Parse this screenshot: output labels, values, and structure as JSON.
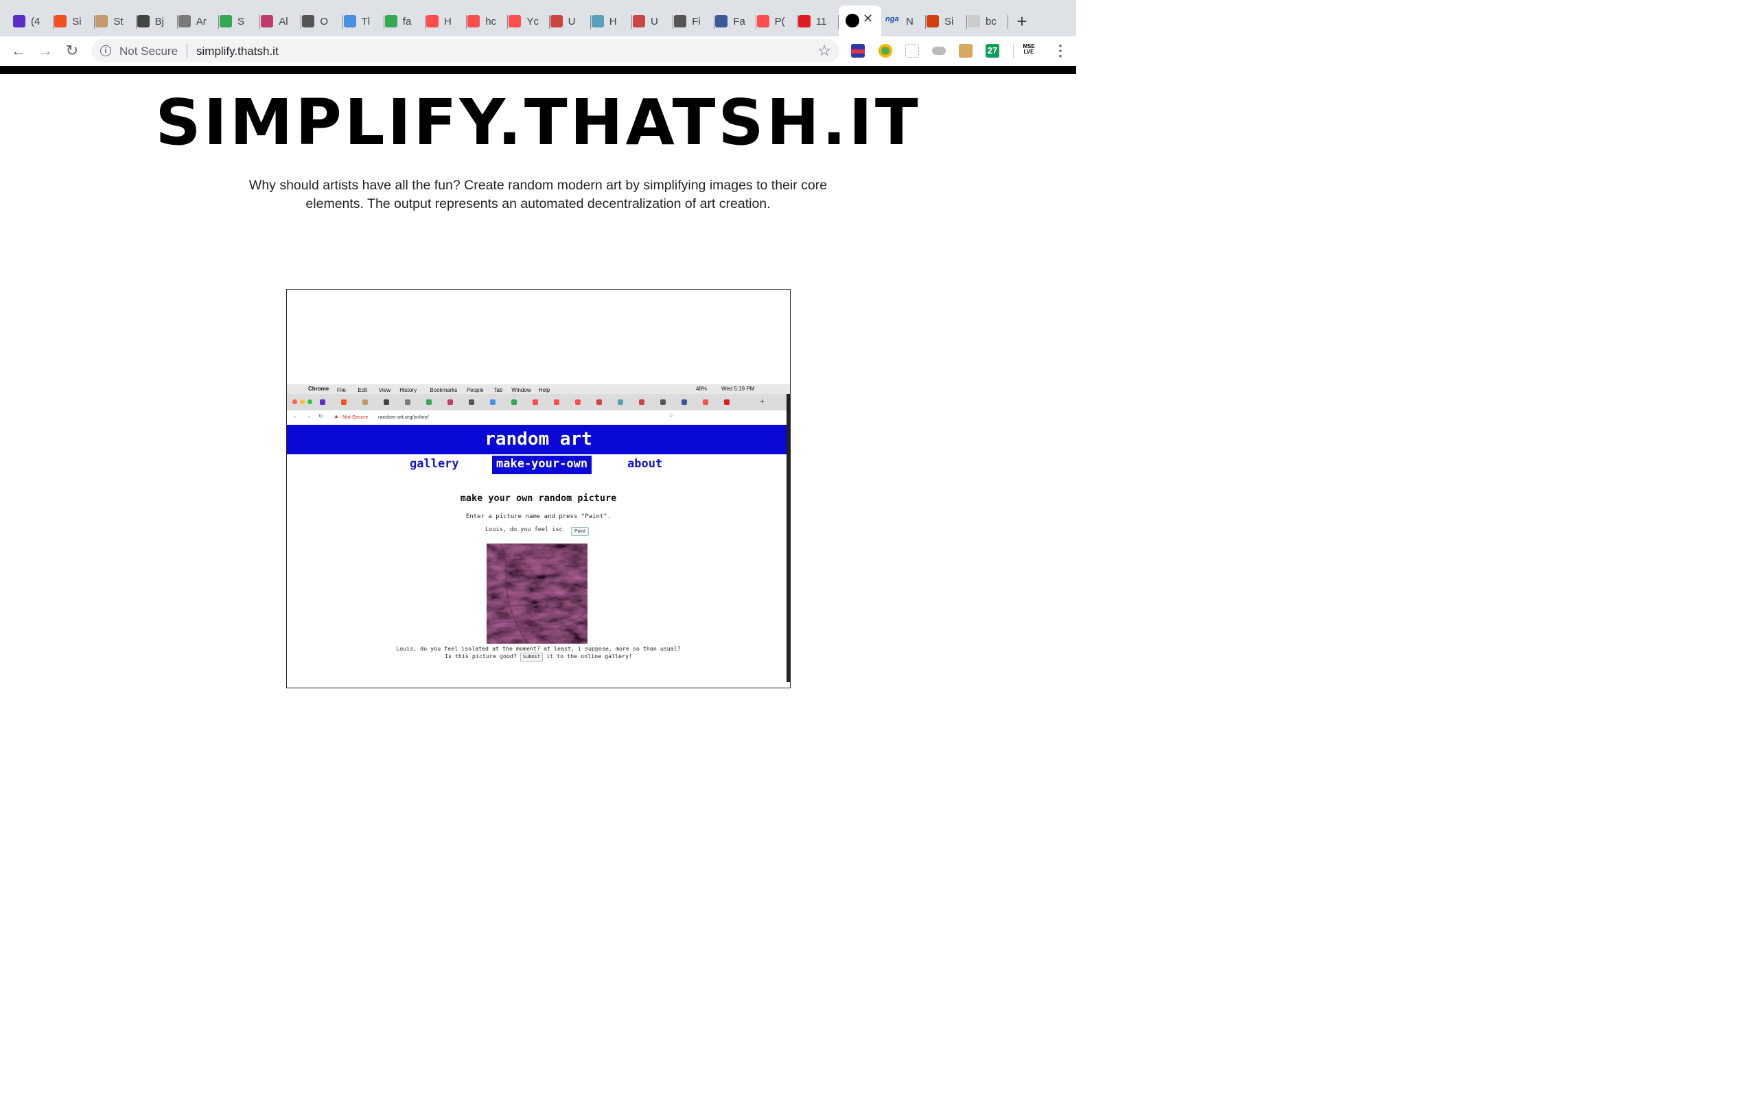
{
  "browser": {
    "tabs": [
      {
        "label": "(4",
        "color": "#5b2ec9"
      },
      {
        "label": "Si",
        "color": "#f25022"
      },
      {
        "label": "St",
        "color": "#c49a6c"
      },
      {
        "label": "Bj",
        "color": "#444444"
      },
      {
        "label": "Ar",
        "color": "#7a7a7a"
      },
      {
        "label": "S",
        "color": "#34a853"
      },
      {
        "label": "Al",
        "color": "#c33b6a"
      },
      {
        "label": "O",
        "color": "#555555"
      },
      {
        "label": "Tl",
        "color": "#4a90e2"
      },
      {
        "label": "fa",
        "color": "#34a853"
      },
      {
        "label": "H",
        "color": "#ff4d4d"
      },
      {
        "label": "hc",
        "color": "#ff4d4d"
      },
      {
        "label": "Yc",
        "color": "#ff4d4d"
      },
      {
        "label": "U",
        "color": "#cc4444"
      },
      {
        "label": "H",
        "color": "#5aa0b8"
      },
      {
        "label": "U",
        "color": "#cc4444"
      },
      {
        "label": "Fi",
        "color": "#555555"
      },
      {
        "label": "Fa",
        "color": "#3b5998"
      },
      {
        "label": "P(",
        "color": "#ff4d4d"
      },
      {
        "label": "11",
        "color": "#e11b22"
      }
    ],
    "tabs_after": [
      {
        "label": "N",
        "color": "#1a4f9c",
        "badge": "nga"
      },
      {
        "label": "Si",
        "color": "#d04010"
      },
      {
        "label": "bc",
        "color": "#cccccc"
      }
    ],
    "active_tab_close": "✕",
    "new_tab": "+",
    "not_secure": "Not Secure",
    "url": "simplify.thatsh.it",
    "ext_label": "MSE LVE"
  },
  "page": {
    "title": "SIMPLIFY.THATSH.IT",
    "description": "Why should artists have all the fun? Create random modern art by simplifying images to their core elements. The output represents an automated decentralization of art creation."
  },
  "embedded": {
    "menubar": {
      "app": "Chrome",
      "items": [
        "File",
        "Edit",
        "View",
        "History",
        "Bookmarks",
        "People",
        "Tab",
        "Window",
        "Help"
      ],
      "battery": "48%",
      "clock": "Wed 5:19 PM"
    },
    "url": {
      "not_secure": "Not Secure",
      "address": "random-art.org/online/"
    },
    "site_title": "random art",
    "nav": {
      "gallery": "gallery",
      "make": "make-your-own",
      "about": "about"
    },
    "heading": "make your own random picture",
    "instructions": "Enter a picture name and press \"Paint\".",
    "input_value": "Louis, do you feel isc",
    "paint_button": "Paint",
    "caption_line1": "Louis, do you feel isolated at the moment? at least, i suppose, more so than usual?",
    "caption_pre": "Is this picture good?",
    "submit_button": "Submit",
    "caption_post": "it to the online gallery!"
  }
}
